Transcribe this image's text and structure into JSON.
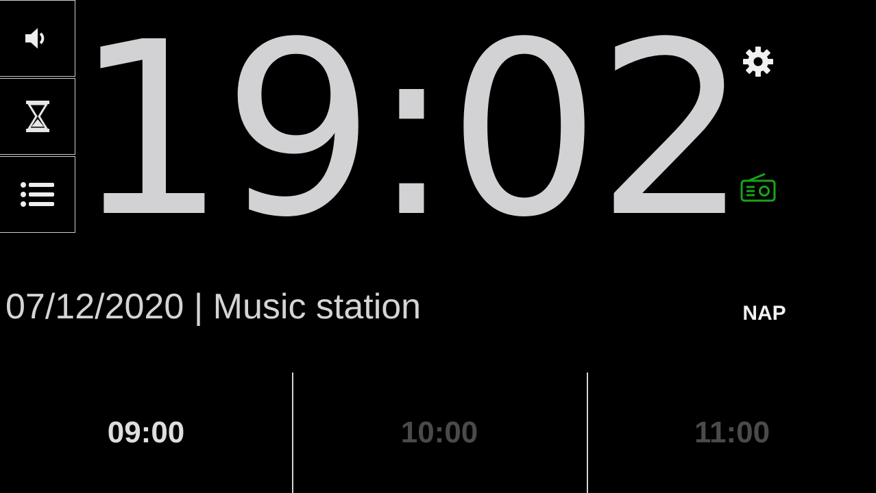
{
  "clock": {
    "time": "19:02"
  },
  "info": {
    "date_line": "07/12/2020 | Music station"
  },
  "side_buttons": [
    {
      "icon": "speaker-icon"
    },
    {
      "icon": "hourglass-icon"
    },
    {
      "icon": "list-icon"
    }
  ],
  "right_controls": {
    "settings_icon": "gear-icon",
    "radio_icon": "radio-icon",
    "radio_color": "#1aa31a",
    "nap_label": "NAP"
  },
  "alarms": [
    {
      "time": "09:00",
      "enabled": true
    },
    {
      "time": "10:00",
      "enabled": false
    },
    {
      "time": "11:00",
      "enabled": false
    }
  ]
}
